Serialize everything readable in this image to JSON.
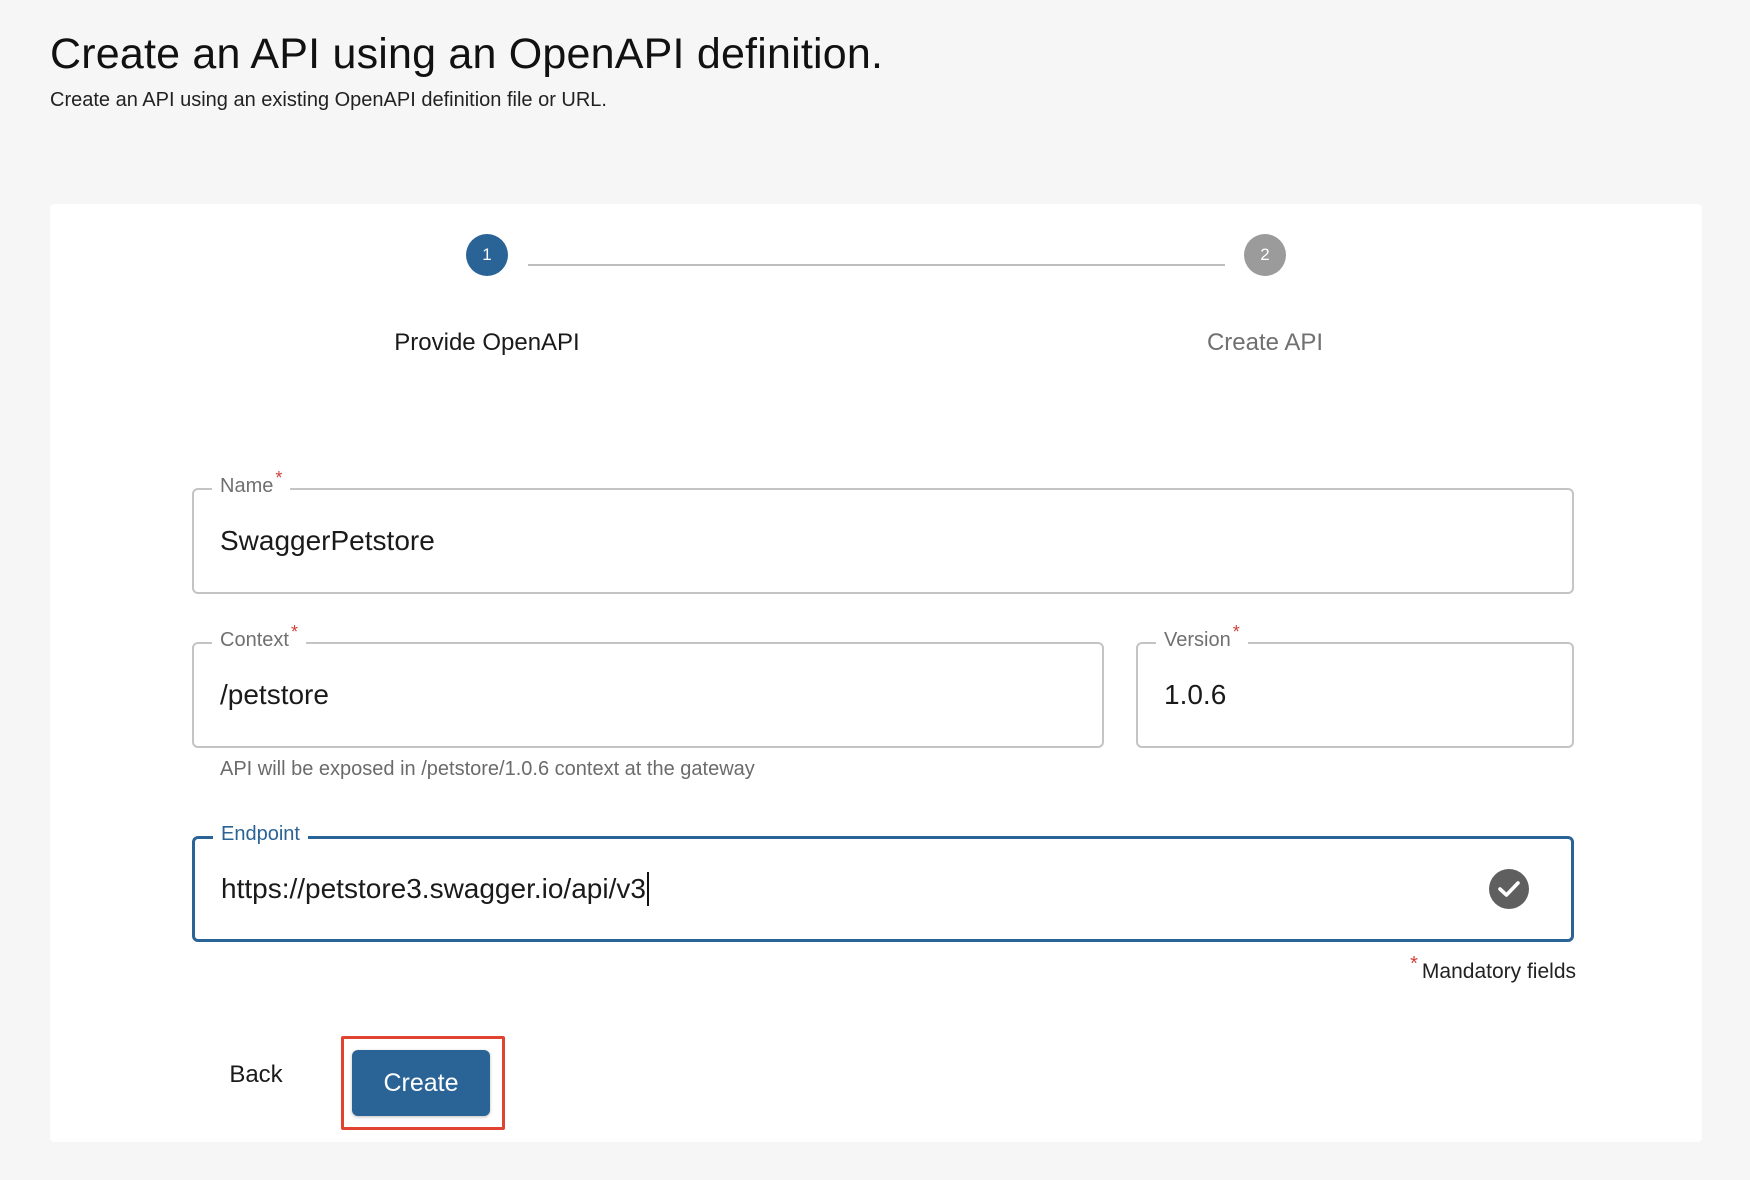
{
  "header": {
    "title": "Create an API using an OpenAPI definition.",
    "subtitle": "Create an API using an existing OpenAPI definition file or URL."
  },
  "stepper": {
    "steps": [
      {
        "number": "1",
        "label": "Provide OpenAPI",
        "state": "active"
      },
      {
        "number": "2",
        "label": "Create API",
        "state": "inactive"
      }
    ]
  },
  "form": {
    "name": {
      "label": "Name",
      "required_mark": "*",
      "value": "SwaggerPetstore"
    },
    "context": {
      "label": "Context",
      "required_mark": "*",
      "value": "/petstore"
    },
    "version": {
      "label": "Version",
      "required_mark": "*",
      "value": "1.0.6"
    },
    "context_helper": "API will be exposed in /petstore/1.0.6 context at the gateway",
    "endpoint": {
      "label": "Endpoint",
      "value": "https://petstore3.swagger.io/api/v3",
      "status_icon": "check-circle-icon"
    },
    "mandatory_mark": "*",
    "mandatory_note": "Mandatory fields"
  },
  "actions": {
    "back_label": "Back",
    "create_label": "Create"
  },
  "colors": {
    "primary": "#2a6496",
    "required": "#d0413a",
    "highlight": "#e0432f"
  }
}
